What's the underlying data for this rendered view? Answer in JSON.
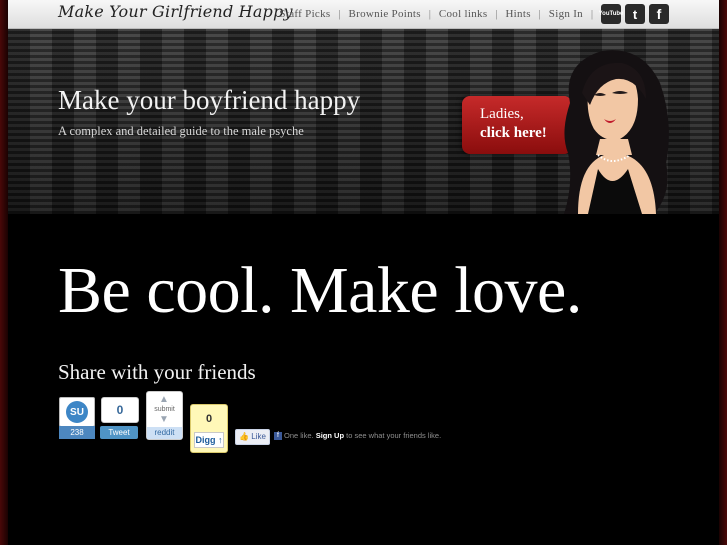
{
  "header": {
    "logo": "Make Your Girlfriend Happy",
    "nav": [
      "Staff Picks",
      "Brownie Points",
      "Cool links",
      "Hints",
      "Sign In"
    ],
    "social": [
      "YouTube",
      "t",
      "f"
    ]
  },
  "banner": {
    "title": "Make your boyfriend happy",
    "subtitle": "A complex and detailed guide to the male psyche",
    "cta_line1": "Ladies,",
    "cta_line2": "click here!"
  },
  "main": {
    "headline": "Be cool. Make love.",
    "share_heading": "Share with your friends"
  },
  "widgets": {
    "stumble_icon": "SU",
    "stumble_count": "238",
    "tweet_count": "0",
    "tweet_label": "Tweet",
    "reddit_submit": "submit",
    "reddit_label": "reddit",
    "digg_count": "0",
    "digg_label": "Digg",
    "fb_like_label": "Like",
    "fb_text_pre": "One like.",
    "fb_signup": "Sign Up",
    "fb_text_post": "to see what your friends like."
  }
}
